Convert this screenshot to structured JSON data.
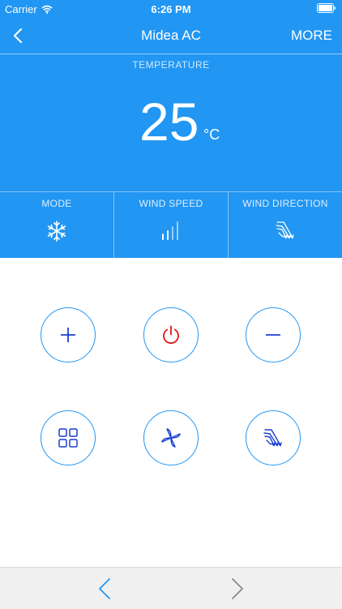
{
  "status_bar": {
    "carrier": "Carrier",
    "time": "6:26 PM"
  },
  "nav": {
    "title": "Midea AC",
    "more_label": "MORE"
  },
  "temperature": {
    "label": "TEMPERATURE",
    "value": "25",
    "unit": "°C"
  },
  "modes": [
    {
      "label": "MODE",
      "icon": "snowflake-icon"
    },
    {
      "label": "WIND SPEED",
      "icon": "signal-bars-icon"
    },
    {
      "label": "WIND DIRECTION",
      "icon": "swing-icon"
    }
  ],
  "controls": [
    {
      "name": "increase-button",
      "icon": "plus-icon"
    },
    {
      "name": "power-button",
      "icon": "power-icon"
    },
    {
      "name": "decrease-button",
      "icon": "minus-icon"
    },
    {
      "name": "mode-button",
      "icon": "grid-icon"
    },
    {
      "name": "fan-speed-button",
      "icon": "fan-icon"
    },
    {
      "name": "direction-button",
      "icon": "swing-icon"
    }
  ],
  "colors": {
    "primary": "#2196f3",
    "power": "#e02020",
    "icon": "#1a3fd0",
    "bottom_bar": "#f0f0f0"
  }
}
